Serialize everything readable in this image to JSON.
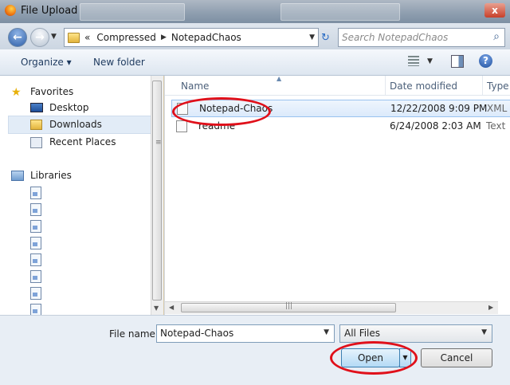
{
  "window": {
    "title": "File Upload",
    "close_glyph": "x"
  },
  "address_bar": {
    "history_glyph": "«",
    "breadcrumbs": [
      "Compressed",
      "NotepadChaos"
    ],
    "search_placeholder": "Search NotepadChaos"
  },
  "toolbar": {
    "organize_label": "Organize",
    "new_folder_label": "New folder"
  },
  "nav": {
    "favorites_label": "Favorites",
    "items": [
      {
        "label": "Desktop",
        "icon": "desktop-icon"
      },
      {
        "label": "Downloads",
        "icon": "folder-icon",
        "selected": true
      },
      {
        "label": "Recent Places",
        "icon": "recent-places-icon"
      }
    ],
    "libraries_label": "Libraries"
  },
  "file_list": {
    "columns": [
      "Name",
      "Date modified",
      "Type"
    ],
    "rows": [
      {
        "name": "Notepad-Chaos",
        "date": "12/22/2008 9:09 PM",
        "type": "XML",
        "selected": true
      },
      {
        "name": "readme",
        "date": "6/24/2008 2:03 AM",
        "type": "Text"
      }
    ]
  },
  "bottom": {
    "file_name_label": "File name:",
    "file_name_value": "Notepad-Chaos",
    "filter_value": "All Files",
    "open_label": "Open",
    "cancel_label": "Cancel"
  },
  "colors": {
    "annotation": "#e0101a",
    "selection": "#dceafb",
    "accent": "#3c7fb1"
  }
}
